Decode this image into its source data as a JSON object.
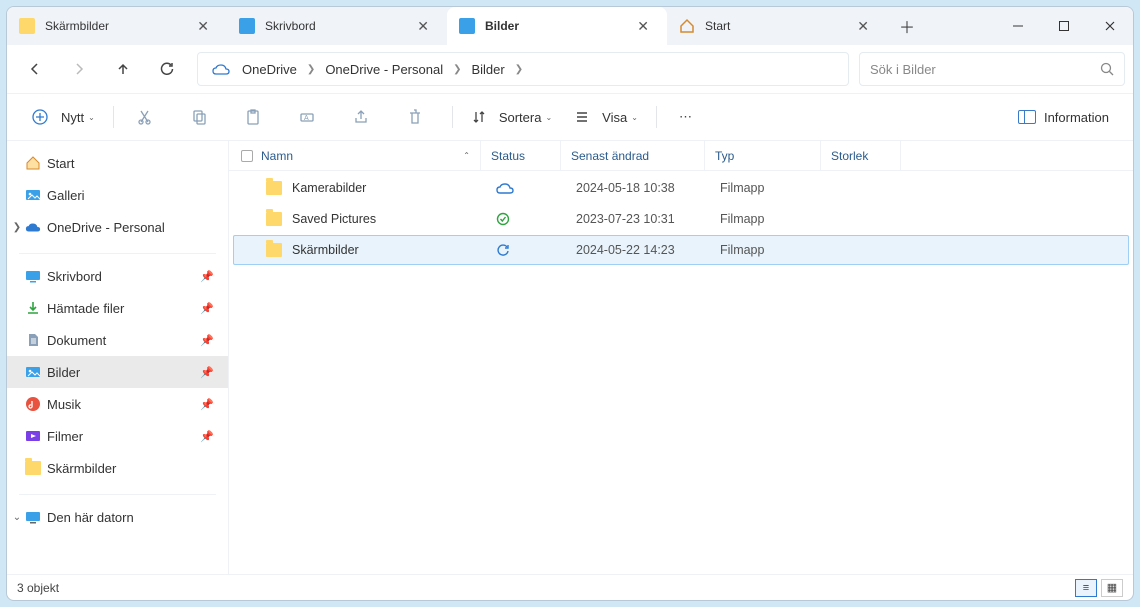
{
  "tabs": [
    {
      "label": "Skärmbilder",
      "icon": "folder",
      "active": false
    },
    {
      "label": "Skrivbord",
      "icon": "desktop",
      "active": false
    },
    {
      "label": "Bilder",
      "icon": "pictures",
      "active": true
    },
    {
      "label": "Start",
      "icon": "home",
      "active": false
    }
  ],
  "breadcrumb": [
    "OneDrive",
    "OneDrive - Personal",
    "Bilder"
  ],
  "search_placeholder": "Sök i Bilder",
  "toolbar": {
    "new": "Nytt",
    "sort": "Sortera",
    "view": "Visa",
    "info": "Information"
  },
  "sidebar": {
    "group1": [
      {
        "label": "Start",
        "icon": "home"
      },
      {
        "label": "Galleri",
        "icon": "gallery"
      },
      {
        "label": "OneDrive - Personal",
        "icon": "onedrive",
        "expandable": true
      }
    ],
    "group2": [
      {
        "label": "Skrivbord",
        "icon": "desktop",
        "pinned": true
      },
      {
        "label": "Hämtade filer",
        "icon": "download",
        "pinned": true
      },
      {
        "label": "Dokument",
        "icon": "document",
        "pinned": true
      },
      {
        "label": "Bilder",
        "icon": "pictures",
        "pinned": true,
        "selected": true
      },
      {
        "label": "Musik",
        "icon": "music",
        "pinned": true
      },
      {
        "label": "Filmer",
        "icon": "video",
        "pinned": true
      },
      {
        "label": "Skärmbilder",
        "icon": "folder"
      }
    ],
    "computer": "Den här datorn"
  },
  "columns": {
    "name": "Namn",
    "status": "Status",
    "modified": "Senast ändrad",
    "type": "Typ",
    "size": "Storlek"
  },
  "rows": [
    {
      "name": "Kamerabilder",
      "status": "cloud",
      "modified": "2024-05-18 10:38",
      "type": "Filmapp",
      "selected": false
    },
    {
      "name": "Saved Pictures",
      "status": "ok",
      "modified": "2023-07-23 10:31",
      "type": "Filmapp",
      "selected": false
    },
    {
      "name": "Skärmbilder",
      "status": "sync",
      "modified": "2024-05-22 14:23",
      "type": "Filmapp",
      "selected": true
    }
  ],
  "status_text": "3 objekt"
}
